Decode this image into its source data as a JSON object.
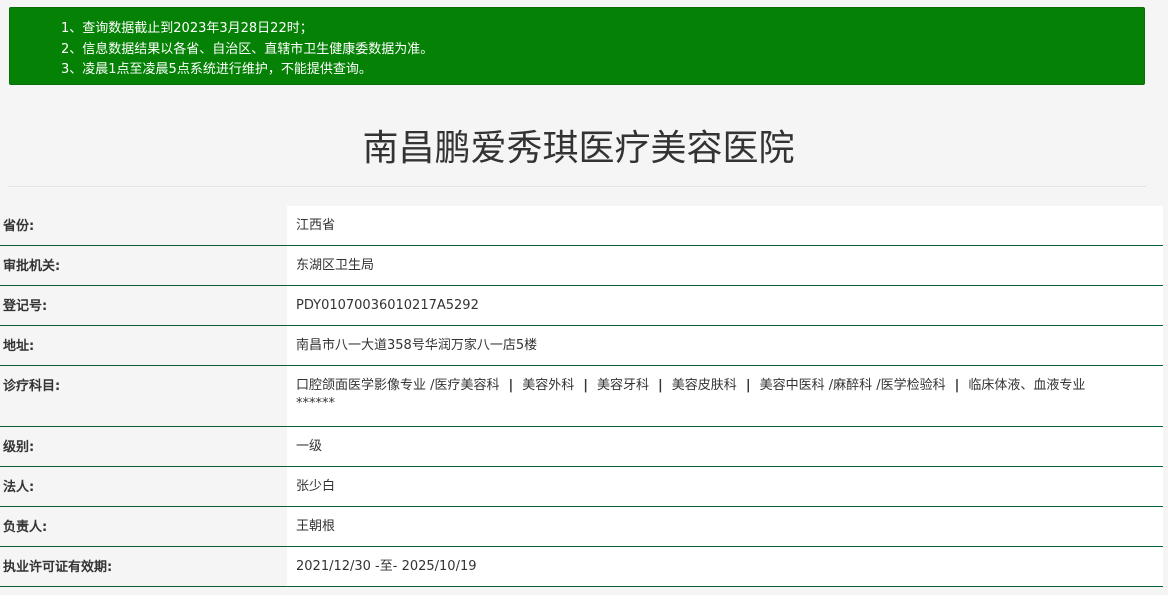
{
  "notice": {
    "lines": [
      "1、查询数据截止到2023年3月28日22时；",
      "2、信息数据结果以各省、自治区、直辖市卫生健康委数据为准。",
      "3、凌晨1点至凌晨5点系统进行维护，不能提供查询。"
    ]
  },
  "hospital": {
    "name": "南昌鹏爱秀琪医疗美容医院"
  },
  "colors": {
    "notice_bg": "#058205",
    "row_divider": "#0b5e34",
    "page_bg": "#f5f5f5"
  },
  "fields": [
    {
      "label": "省份:",
      "value": "江西省"
    },
    {
      "label": "审批机关:",
      "value": "东湖区卫生局"
    },
    {
      "label": "登记号:",
      "value": "PDY01070036010217A5292"
    },
    {
      "label": "地址:",
      "value": "南昌市八一大道358号华润万家八一店5楼"
    },
    {
      "label": "诊疗科目:",
      "departments": [
        "口腔颌面医学影像专业 /医疗美容科",
        "美容外科",
        "美容牙科",
        "美容皮肤科",
        "美容中医科 /麻醉科 /医学检验科",
        "临床体液、血液专业"
      ],
      "separator": "|",
      "trailing": "******"
    },
    {
      "label": "级别:",
      "value": "一级"
    },
    {
      "label": "法人:",
      "value": "张少白"
    },
    {
      "label": "负责人:",
      "value": "王朝根"
    },
    {
      "label": "执业许可证有效期:",
      "value": "2021/12/30 -至- 2025/10/19"
    }
  ]
}
